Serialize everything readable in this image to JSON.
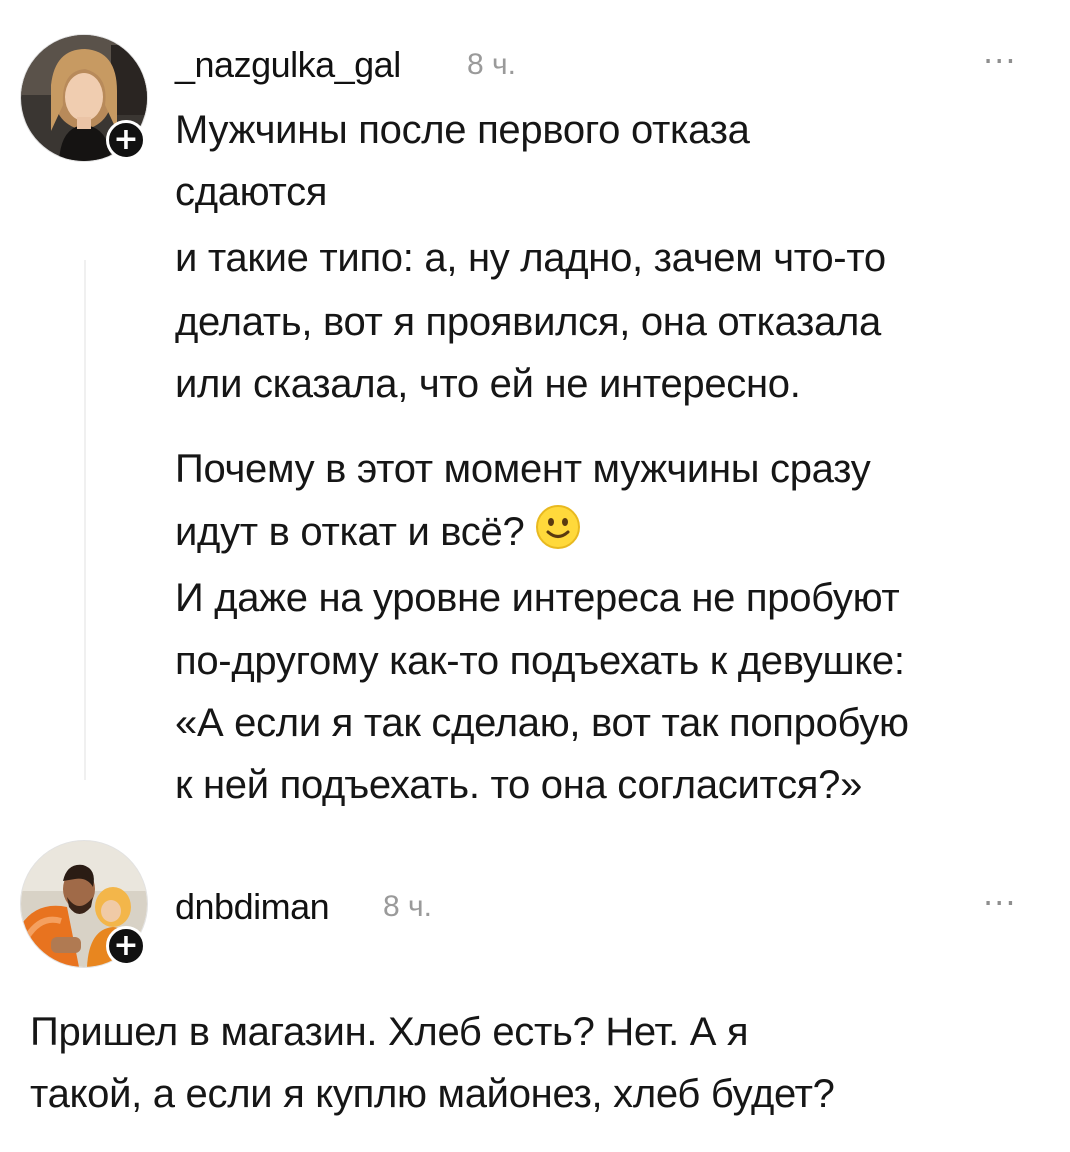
{
  "comments": [
    {
      "username": "_nazgulka_gal",
      "time": "8 ч.",
      "more": "···",
      "follow": "+",
      "avatar_icon": "user-avatar-woman",
      "paragraph1": [
        "Мужчины после первого отказа",
        "сдаются",
        "и такие типо: а, ну ладно, зачем что-то",
        "делать, вот я проявился, она отказала",
        "или сказала, что ей не интересно."
      ],
      "paragraph2": [
        "Почему в этот момент мужчины сразу",
        "идут в откат и всё?",
        "И даже на уровне интереса не пробуют",
        "по-другому как-то подъехать к девушке:",
        "«А если я так сделаю, вот так попробую",
        "к ней подъехать. то она согласится?»"
      ],
      "emoji": "slightly-smiling-face-emoji"
    },
    {
      "username": "dnbdiman",
      "time": "8 ч.",
      "more": "···",
      "follow": "+",
      "avatar_icon": "user-avatar-man-with-child",
      "lines": [
        "Пришел в магазин. Хлеб есть? Нет. А я",
        "такой, а если я куплю майонез, хлеб будет?"
      ]
    }
  ],
  "colors": {
    "text": "#161616",
    "meta": "#9a9a9a",
    "badge": "#111111",
    "background": "#ffffff"
  }
}
